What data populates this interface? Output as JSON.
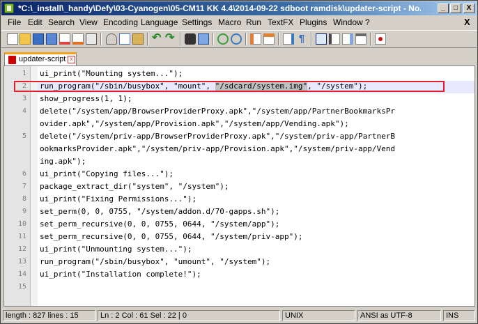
{
  "window": {
    "title": "*C:\\_install\\_handy\\Defy\\03-Cyanogen\\05-CM11 KK 4.4\\2014-09-22 sdboot ramdisk\\updater-script - No...",
    "minimize_glyph": "_",
    "maximize_glyph": "□",
    "close_glyph": "X"
  },
  "menu": {
    "items": [
      "File",
      "Edit",
      "Search",
      "View",
      "Encoding",
      "Language",
      "Settings",
      "Macro",
      "Run",
      "TextFX",
      "Plugins",
      "Window",
      "?"
    ],
    "close_glyph": "X"
  },
  "toolbar": {
    "icons": [
      "new-file-icon",
      "open-file-icon",
      "save-icon",
      "save-all-icon",
      "close-file-icon",
      "close-all-icon",
      "print-icon",
      "cut-icon",
      "copy-icon",
      "paste-icon",
      "undo-icon",
      "redo-icon",
      "find-icon",
      "replace-icon",
      "zoom-in-icon",
      "zoom-out-icon",
      "sync-vertical-icon",
      "sync-horizontal-icon",
      "word-wrap-icon",
      "show-all-chars-icon",
      "indent-guide-icon",
      "user-lang-icon",
      "doc-map-icon",
      "function-list-icon",
      "record-macro-icon"
    ]
  },
  "tab": {
    "label": "updater-script",
    "close_glyph": "x"
  },
  "editor": {
    "current_line": 2,
    "lines": [
      {
        "num": "1",
        "pre": "ui_print(\"Mounting system...\");",
        "sel": "",
        "post": ""
      },
      {
        "num": "2",
        "pre": "run_program(\"/sbin/busybox\", \"mount\", ",
        "sel": "\"/sdcard/system.img\"",
        "post": ", \"/system\");"
      },
      {
        "num": "3",
        "pre": "show_progress(1, 1);",
        "sel": "",
        "post": ""
      },
      {
        "num": "4",
        "pre": "delete(\"/system/app/BrowserProviderProxy.apk\",\"/system/app/PartnerBookmarksPr",
        "sel": "",
        "post": ""
      },
      {
        "num": "",
        "pre": "ovider.apk\",\"/system/app/Provision.apk\",\"/system/app/Vending.apk\");",
        "sel": "",
        "post": ""
      },
      {
        "num": "5",
        "pre": "delete(\"/system/priv-app/BrowserProviderProxy.apk\",\"/system/priv-app/PartnerB",
        "sel": "",
        "post": ""
      },
      {
        "num": "",
        "pre": "ookmarksProvider.apk\",\"/system/priv-app/Provision.apk\",\"/system/priv-app/Vend",
        "sel": "",
        "post": ""
      },
      {
        "num": "",
        "pre": "ing.apk\");",
        "sel": "",
        "post": ""
      },
      {
        "num": "6",
        "pre": "ui_print(\"Copying files...\");",
        "sel": "",
        "post": ""
      },
      {
        "num": "7",
        "pre": "package_extract_dir(\"system\", \"/system\");",
        "sel": "",
        "post": ""
      },
      {
        "num": "8",
        "pre": "ui_print(\"Fixing Permissions...\");",
        "sel": "",
        "post": ""
      },
      {
        "num": "9",
        "pre": "set_perm(0, 0, 0755, \"/system/addon.d/70-gapps.sh\");",
        "sel": "",
        "post": ""
      },
      {
        "num": "10",
        "pre": "set_perm_recursive(0, 0, 0755, 0644, \"/system/app\");",
        "sel": "",
        "post": ""
      },
      {
        "num": "11",
        "pre": "set_perm_recursive(0, 0, 0755, 0644, \"/system/priv-app\");",
        "sel": "",
        "post": ""
      },
      {
        "num": "12",
        "pre": "ui_print(\"Unmounting system...\");",
        "sel": "",
        "post": ""
      },
      {
        "num": "13",
        "pre": "run_program(\"/sbin/busybox\", \"umount\", \"/system\");",
        "sel": "",
        "post": ""
      },
      {
        "num": "14",
        "pre": "ui_print(\"Installation complete!\");",
        "sel": "",
        "post": ""
      },
      {
        "num": "15",
        "pre": "",
        "sel": "",
        "post": ""
      }
    ]
  },
  "status": {
    "length_lines": "length : 827    lines : 15",
    "position": "Ln : 2    Col : 61    Sel : 22 | 0",
    "eol": "UNIX",
    "encoding": "ANSI as UTF-8",
    "mode": "INS"
  },
  "colors": {
    "title_start": "#0a246a",
    "highlight_box": "#e0202a",
    "selection": "#c0c0c0",
    "tab_accent": "#f8a01a"
  }
}
